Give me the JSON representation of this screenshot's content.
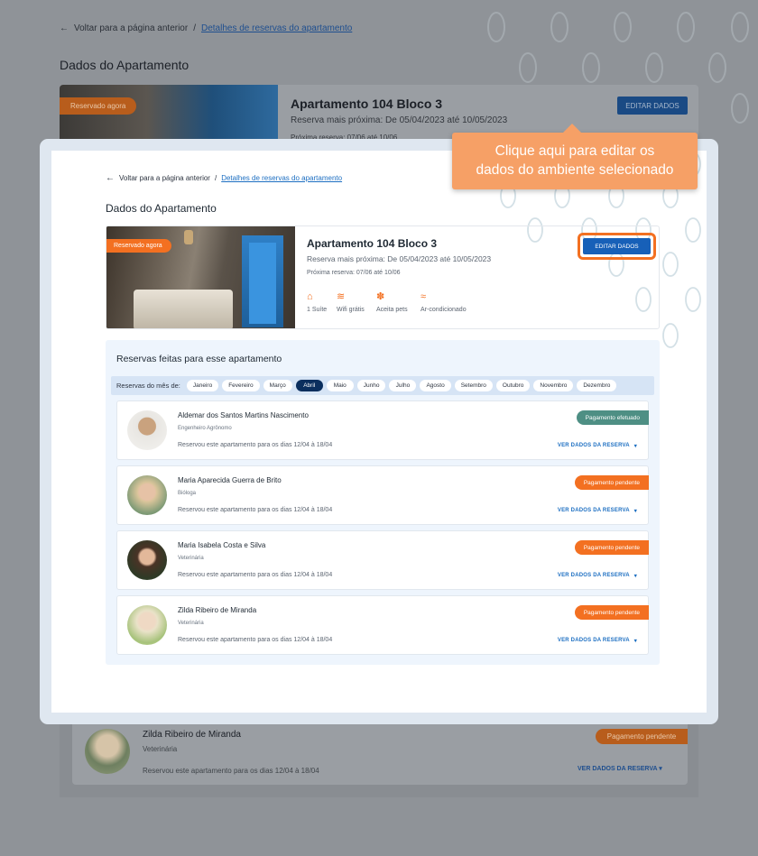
{
  "background": {
    "breadcrumb": {
      "back": "Voltar para a página anterior",
      "sep": "/",
      "current": "Detalhes de reservas do apartamento"
    },
    "title": "Dados do Apartamento",
    "badge": "Reservado agora",
    "apartment": "Apartamento 104 Bloco 3",
    "nearest": "Reserva mais próxima: De 05/04/2023 até 10/05/2023",
    "next": "Próxima reserva: 07/06 até 10/06",
    "edit_label": "EDITAR DADOS",
    "reservation": {
      "name": "Zilda Ribeiro de Miranda",
      "profession": "Veterinária",
      "text": "Reservou este apartamento para os dias 12/04 à 18/04",
      "status": "Pagamento pendente",
      "details": "VER DADOS DA RESERVA"
    }
  },
  "breadcrumb": {
    "back": "Voltar para a página anterior",
    "sep": "/",
    "current": "Detalhes de reservas do apartamento"
  },
  "page_title": "Dados do Apartamento",
  "apartment": {
    "badge": "Reservado agora",
    "name": "Apartamento 104 Bloco 3",
    "nearest": "Reserva mais próxima: De 05/04/2023 até 10/05/2023",
    "next": "Próxima reserva: 07/06 até 10/06",
    "edit_label": "EDITAR DADOS",
    "amenities": [
      {
        "icon": "bathtub-icon",
        "glyph": "⌂",
        "label": "1 Suíte"
      },
      {
        "icon": "wifi-icon",
        "glyph": "≋",
        "label": "Wifi grátis"
      },
      {
        "icon": "paw-icon",
        "glyph": "✽",
        "label": "Aceita pets"
      },
      {
        "icon": "air-conditioner-icon",
        "glyph": "≈",
        "label": "Ar-condicionado"
      }
    ]
  },
  "callout": {
    "line1": "Clique aqui para editar os",
    "line2": "dados do ambiente selecionado"
  },
  "reservations": {
    "title": "Reservas feitas para esse apartamento",
    "month_label": "Reservas do mês de:",
    "months": [
      "Janeiro",
      "Fevereiro",
      "Março",
      "Abril",
      "Maio",
      "Junho",
      "Julho",
      "Agosto",
      "Setembro",
      "Outubro",
      "Novembro",
      "Dezembro"
    ],
    "active_month": "Abril",
    "details_label": "VER DADOS DA RESERVA",
    "chevron": "▾",
    "items": [
      {
        "name": "Aldemar dos Santos Martins Nascimento",
        "profession": "Engenheiro Agrônomo",
        "text": "Reservou este apartamento para os dias 12/04 à 18/04",
        "status": "Pagamento efetuado",
        "status_type": "ok"
      },
      {
        "name": "Maria Aparecida Guerra de Brito",
        "profession": "Bióloga",
        "text": "Reservou este apartamento para os dias 12/04 à 18/04",
        "status": "Pagamento pendente",
        "status_type": "pend"
      },
      {
        "name": "Maria Isabela Costa e Silva",
        "profession": "Veterinária",
        "text": "Reservou este apartamento para os dias 12/04 à 18/04",
        "status": "Pagamento pendente",
        "status_type": "pend"
      },
      {
        "name": "Zilda Ribeiro de Miranda",
        "profession": "Veterinária",
        "text": "Reservou este apartamento para os dias 12/04 à 18/04",
        "status": "Pagamento pendente",
        "status_type": "pend"
      }
    ]
  },
  "colors": {
    "accent": "#f37021",
    "primary": "#1760b8",
    "success": "#4e8f84",
    "navy": "#0b2f5e"
  }
}
